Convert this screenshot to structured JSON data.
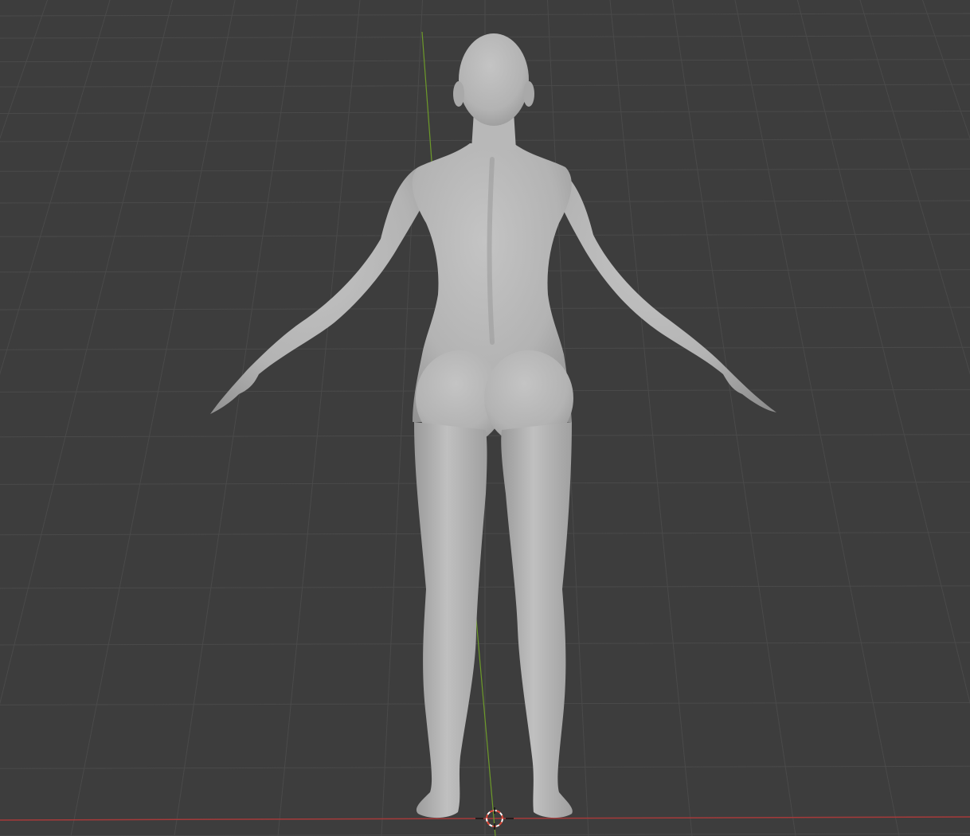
{
  "viewport": {
    "background": "#3d3d3d",
    "grid_color": "#4a4a4a",
    "x_axis_color": "#a63a3a",
    "y_axis_color": "#6d9a2a",
    "model_color": "#b5b5b5",
    "cursor_color": "#e04a3a"
  },
  "scene": {
    "model_name": "female-base-mesh",
    "pose": "A-pose",
    "view": "back"
  }
}
